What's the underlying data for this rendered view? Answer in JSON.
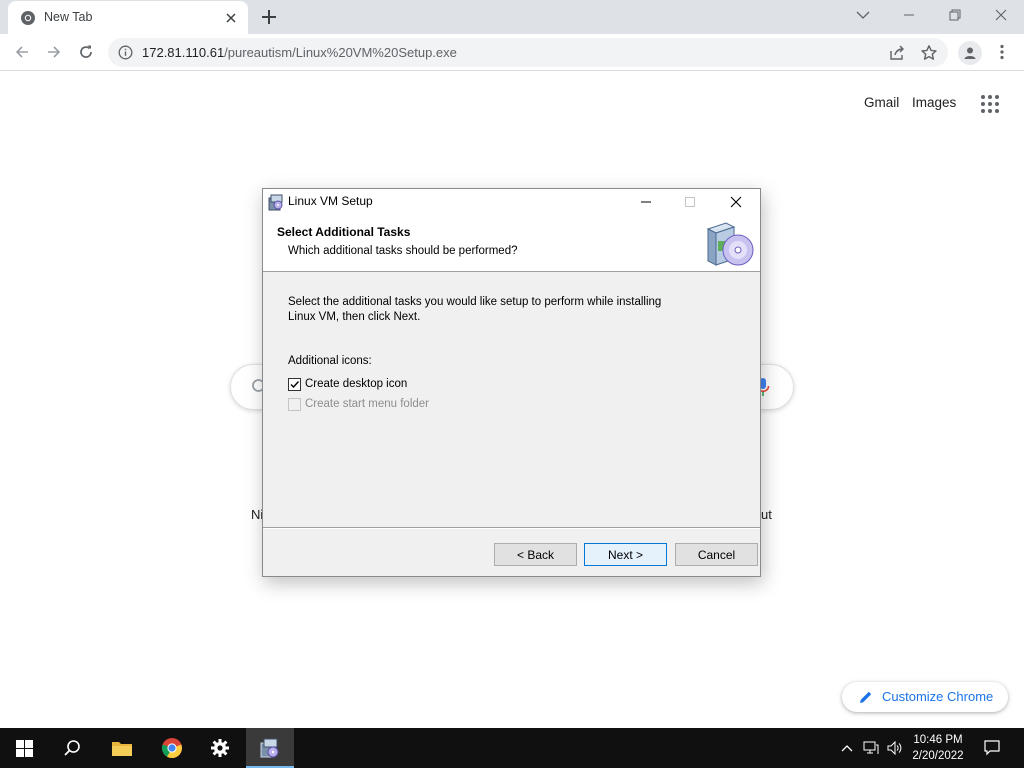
{
  "browser": {
    "tab_title": "New Tab",
    "url_host": "172.81.110.61",
    "url_path": "/pureautism/Linux%20VM%20Setup.exe"
  },
  "ntp": {
    "gmail_label": "Gmail",
    "images_label": "Images",
    "shortcut_left_fragment": "Ni",
    "shortcut_right_fragment": "ut",
    "customize_label": "Customize Chrome"
  },
  "dialog": {
    "title": "Linux VM Setup",
    "heading": "Select Additional Tasks",
    "subheading": "Which additional tasks should be performed?",
    "intro_line1": "Select the additional tasks you would like setup to perform while installing",
    "intro_line2": "Linux VM, then click Next.",
    "group_label": "Additional icons:",
    "tasks": [
      {
        "label": "Create desktop icon",
        "checked": true,
        "enabled": true
      },
      {
        "label": "Create start menu folder",
        "checked": false,
        "enabled": false
      }
    ],
    "back_label": "< Back",
    "next_label": "Next >",
    "cancel_label": "Cancel"
  },
  "taskbar": {
    "time": "10:46 PM",
    "date": "2/20/2022"
  },
  "colors": {
    "accent": "#1a73e8",
    "taskbar": "#101010",
    "dialog_bg": "#f0f0f0"
  }
}
